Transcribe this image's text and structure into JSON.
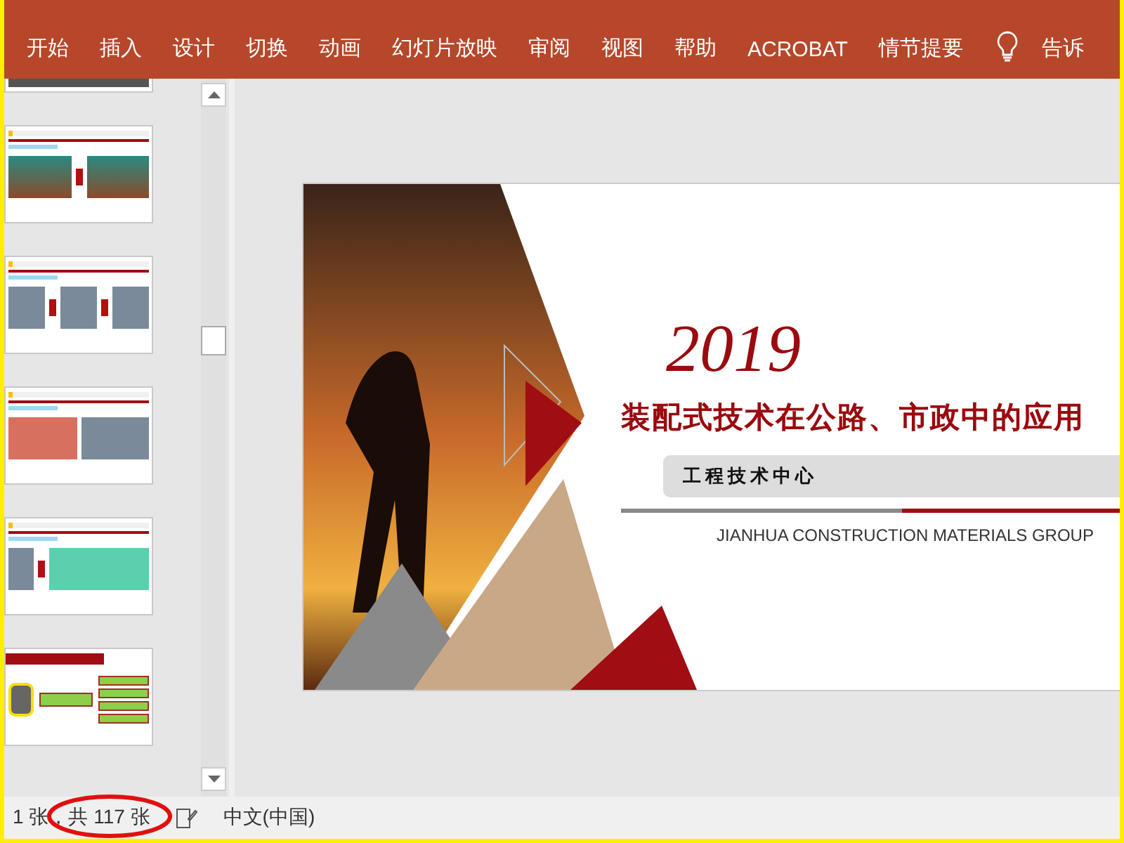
{
  "ribbon": {
    "tabs": [
      "开始",
      "插入",
      "设计",
      "切换",
      "动画",
      "幻灯片放映",
      "审阅",
      "视图",
      "帮助",
      "ACROBAT",
      "情节提要"
    ],
    "tell_me": "告诉"
  },
  "thumbnails": [
    {
      "kind": "partial"
    },
    {
      "kind": "pair"
    },
    {
      "kind": "triple"
    },
    {
      "kind": "callout"
    },
    {
      "kind": "compare"
    },
    {
      "kind": "mindmap"
    }
  ],
  "slide": {
    "year": "2019",
    "title": "装配式技术在公路、市政中的应用",
    "subtitle": "工程技术中心",
    "company": "JIANHUA CONSTRUCTION MATERIALS GROUP"
  },
  "status_bar": {
    "slide_count": "1 张，共 117 张",
    "language": "中文(中国)"
  }
}
